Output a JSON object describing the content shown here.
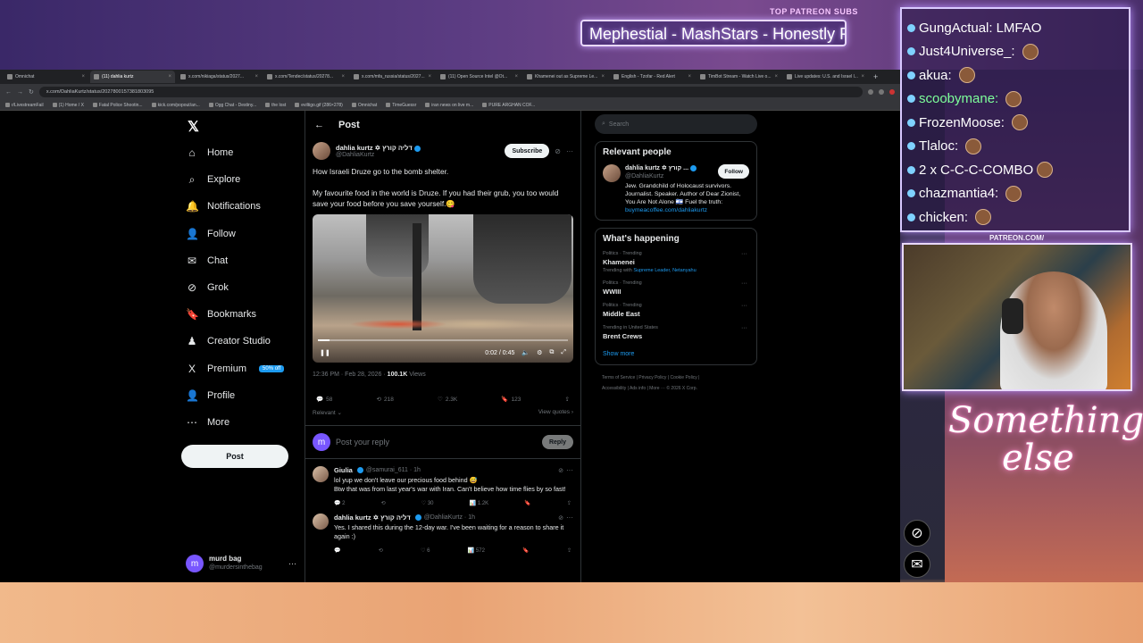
{
  "overlay": {
    "patreon_label": "TOP PATREON SUBS",
    "patreon_ticker": "Mephestial - MashStars - Honestly Re",
    "patreon_url": "PATREON.COM/",
    "signature_line1": "Something",
    "signature_line2": "else",
    "chat": [
      {
        "user": "GungActual:",
        "msg": "LMFAO",
        "emote": false,
        "green": false
      },
      {
        "user": "Just4Universe_:",
        "msg": "",
        "emote": true,
        "green": false
      },
      {
        "user": "akua:",
        "msg": "",
        "emote": true,
        "green": false
      },
      {
        "user": "scoobymane:",
        "msg": "",
        "emote": true,
        "green": true
      },
      {
        "user": "FrozenMoose:",
        "msg": "",
        "emote": true,
        "green": false
      },
      {
        "user": "Tlaloc:",
        "msg": "",
        "emote": true,
        "green": false
      },
      {
        "user": "2 x",
        "msg": "C-C-C-COMBO",
        "emote": true,
        "green": false
      },
      {
        "user": "chazmantia4:",
        "msg": "",
        "emote": true,
        "green": false
      },
      {
        "user": "chicken:",
        "msg": "",
        "emote": true,
        "green": false
      }
    ]
  },
  "browser": {
    "tabs": [
      {
        "label": "Omnichat",
        "active": false
      },
      {
        "label": "(11) dahlia kurtz",
        "active": true
      },
      {
        "label": "x.com/nikiaga/status/2027...",
        "active": false
      },
      {
        "label": "x.com/Tendec/status/20278...",
        "active": false
      },
      {
        "label": "x.com/mfa_russia/status/2027...",
        "active": false
      },
      {
        "label": "(11) Open Source Intel @Ot...",
        "active": false
      },
      {
        "label": "Khamenei out as Supreme Le...",
        "active": false
      },
      {
        "label": "English - Tzofar - Red Alert",
        "active": false
      },
      {
        "label": "TimBot Stream - Watch Live o...",
        "active": false
      },
      {
        "label": "Live updates: U.S. and Israel l...",
        "active": false
      }
    ],
    "url": "x.com/DahliaKurtz/status/2027800157381803095",
    "bookmarks": [
      "r/LivestreamFail",
      "(1) Home / X",
      "Fatal Police Shootin...",
      "kick.com/popout/an...",
      "Ogg Chat - Destiny...",
      "the lost",
      "eviltigo.gif (286×278)",
      "Omnichat",
      "TimeGuessr",
      "iran news on live m...",
      "PURE ARGHAN COF..."
    ]
  },
  "nav": {
    "items": [
      {
        "icon": "⌂",
        "label": "Home",
        "name": "home"
      },
      {
        "icon": "⌕",
        "label": "Explore",
        "name": "explore"
      },
      {
        "icon": "🔔",
        "label": "Notifications",
        "name": "notifications"
      },
      {
        "icon": "👤",
        "label": "Follow",
        "name": "follow"
      },
      {
        "icon": "✉",
        "label": "Chat",
        "name": "chat"
      },
      {
        "icon": "⊘",
        "label": "Grok",
        "name": "grok"
      },
      {
        "icon": "🔖",
        "label": "Bookmarks",
        "name": "bookmarks"
      },
      {
        "icon": "♟",
        "label": "Creator Studio",
        "name": "creator-studio"
      },
      {
        "icon": "X",
        "label": "Premium",
        "name": "premium"
      },
      {
        "icon": "👤",
        "label": "Profile",
        "name": "profile"
      },
      {
        "icon": "⋯",
        "label": "More",
        "name": "more"
      }
    ],
    "premium_badge": "50% off",
    "post_button": "Post",
    "account_name": "murd bag",
    "account_handle": "@murdersinthebag",
    "account_initial": "m"
  },
  "post": {
    "header": "Post",
    "author_name": "dahlia kurtz ✡ דליה קורץ",
    "author_handle": "@DahliaKurtz",
    "subscribe_label": "Subscribe",
    "text1": "How Israeli Druze go to the bomb shelter.",
    "text2": "My favourite food in the world is Druze. If you had their grub, you too would save your food before you save yourself.😋",
    "video_time": "0:02 / 0:45",
    "video_progress": 0.045,
    "timestamp": "12:36 PM · Feb 28, 2026 · ",
    "views_count": "100.1K",
    "views_label": " Views",
    "replies": "58",
    "reposts": "218",
    "likes": "2.3K",
    "bookmarks": "123",
    "relevant_label": "Relevant ⌄",
    "view_quotes": "View quotes ›",
    "reply_placeholder": "Post your reply",
    "reply_button": "Reply",
    "reply_initial": "m"
  },
  "replies": [
    {
      "name": "Giulia",
      "handle": "@samurai_611 · 1h",
      "text": "lol yup we don't leave our precious food behind 😅\nBtw that was from last year's war with Iran. Can't believe how time flies by so fast!",
      "replies": "2",
      "reposts": "",
      "likes": "30",
      "views": "1.2K"
    },
    {
      "name": "dahlia kurtz ✡ דליה קורץ",
      "handle": "@DahliaKurtz · 1h",
      "text": "Yes. I shared this during the 12-day war. I've been waiting for a reason to share it again :)",
      "replies": "",
      "reposts": "",
      "likes": "6",
      "views": "572"
    }
  ],
  "sidebar": {
    "search_placeholder": "Search",
    "relevant_title": "Relevant people",
    "rp_name": "dahlia kurtz ✡ קורץ ...",
    "rp_handle": "@DahliaKurtz",
    "follow_label": "Follow",
    "rp_bio": "Jew. Grandchild of Holocaust survivors. Journalist. Speaker. Author of Dear Zionist, You Are Not Alone 🇮🇱 Fuel the truth:",
    "rp_link": "buymeacoffee.com/dahliakurtz",
    "happening_title": "What's happening",
    "trends": [
      {
        "cat": "Politics · Trending",
        "title": "Khamenei",
        "with_label": "Trending with",
        "with": "Supreme Leader, Netanyahu"
      },
      {
        "cat": "Politics · Trending",
        "title": "WWIII",
        "with_label": "",
        "with": ""
      },
      {
        "cat": "Politics · Trending",
        "title": "Middle East",
        "with_label": "",
        "with": ""
      },
      {
        "cat": "Trending in United States",
        "title": "Brent Crews",
        "with_label": "",
        "with": ""
      }
    ],
    "show_more": "Show more",
    "footer1": "Terms of Service  |  Privacy Policy  |  Cookie Policy  |",
    "footer2": "Accessibility  |  Ads info  |  More ···  © 2026 X Corp."
  }
}
